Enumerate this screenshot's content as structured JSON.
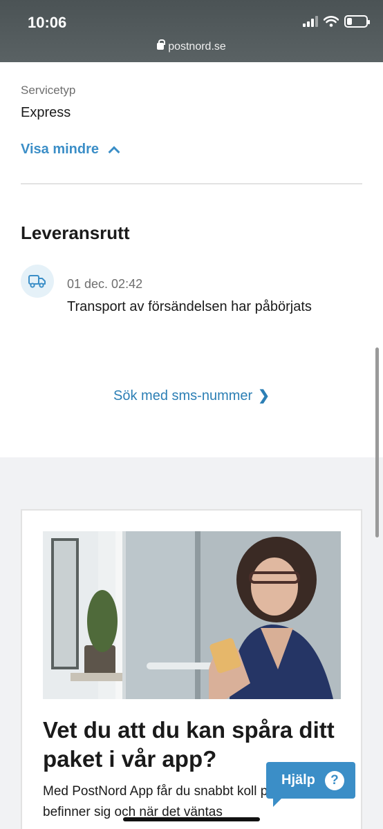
{
  "status_bar": {
    "time": "10:06",
    "url": "postnord.se"
  },
  "details": {
    "service_type_label": "Servicetyp",
    "service_type_value": "Express",
    "toggle_label": "Visa mindre"
  },
  "route": {
    "title": "Leveransrutt",
    "events": [
      {
        "date": "01 dec. 02:42",
        "text": "Transport av försändelsen har påbörjats",
        "icon": "truck-icon"
      }
    ]
  },
  "sms_link": {
    "label": "Sök med sms-nummer",
    "arrow": "❯"
  },
  "promo": {
    "headline": "Vet du att du kan spåra ditt paket i vår app?",
    "body": "Med PostNord App får du snabbt koll på var paketet befinner sig och när det väntas"
  },
  "help_button": {
    "label": "Hjälp",
    "icon": "?"
  },
  "colors": {
    "accent": "#3b8ec7",
    "status_bar": "#4f5759",
    "page_bg_grey": "#f1f2f4"
  }
}
